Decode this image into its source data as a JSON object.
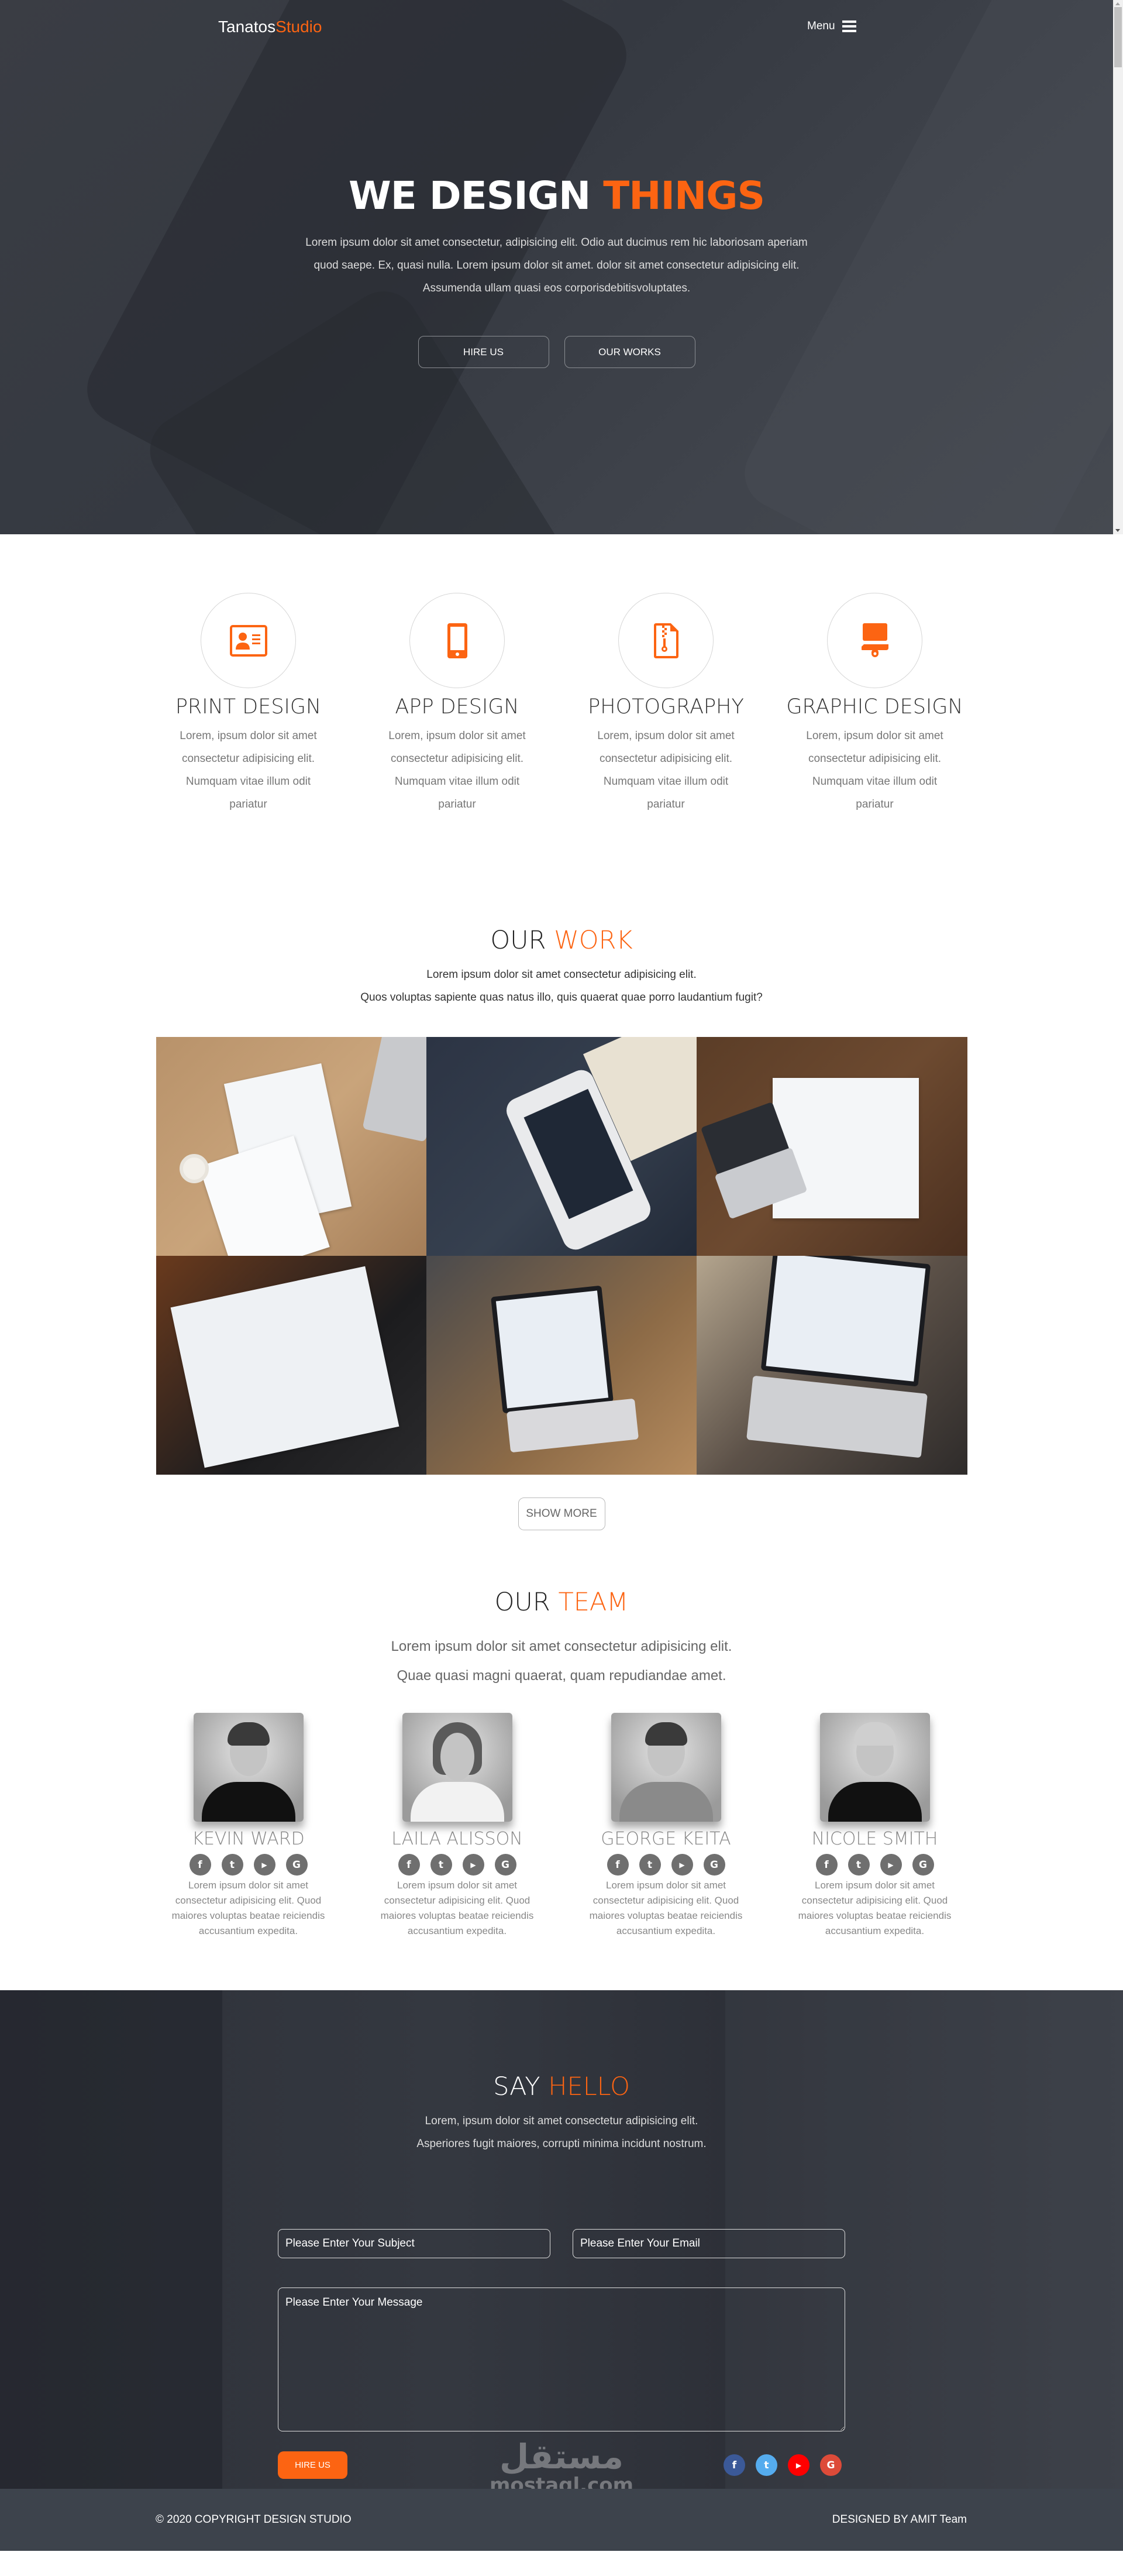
{
  "nav": {
    "logo_primary": "Tanatos",
    "logo_accent": "Studio",
    "menu_label": "Menu",
    "menu_icon": "hamburger-icon"
  },
  "hero": {
    "title_primary": "WE DESIGN",
    "title_accent": "THINGS",
    "text": "Lorem ipsum dolor sit amet consectetur, adipisicing elit. Odio aut ducimus rem hic laboriosam aperiam quod saepe. Ex, quasi nulla. Lorem ipsum dolor sit amet. dolor sit amet consectetur adipisicing elit. Assumenda ullam quasi eos corporisdebitisvoluptates.",
    "buttons": [
      {
        "label": "HIRE US"
      },
      {
        "label": "OUR WORKS"
      }
    ]
  },
  "services": [
    {
      "icon": "id-card-icon",
      "title": "PRINT DESIGN",
      "text": "Lorem, ipsum dolor sit amet consectetur adipisicing elit. Numquam vitae illum odit pariatur"
    },
    {
      "icon": "mobile-phone-icon",
      "title": "APP DESIGN",
      "text": "Lorem, ipsum dolor sit amet consectetur adipisicing elit. Numquam vitae illum odit pariatur"
    },
    {
      "icon": "file-zipper-icon",
      "title": "PHOTOGRAPHY",
      "text": "Lorem, ipsum dolor sit amet consectetur adipisicing elit. Numquam vitae illum odit pariatur"
    },
    {
      "icon": "paint-brush-icon",
      "title": "GRAPHIC DESIGN",
      "text": "Lorem, ipsum dolor sit amet consectetur adipisicing elit. Numquam vitae illum odit pariatur"
    }
  ],
  "work": {
    "title_primary": "OUR",
    "title_accent": "WORK",
    "line1": "Lorem ipsum dolor sit amet consectetur adipisicing elit.",
    "line2": "Quos voluptas sapiente quas natus illo, quis quaerat quae porro laudantium fugit?",
    "tiles": [
      {
        "name": "work-image-charts-documents"
      },
      {
        "name": "work-image-phone-earphones"
      },
      {
        "name": "work-image-planning-board"
      },
      {
        "name": "work-image-notebook-sketch"
      },
      {
        "name": "work-image-laptop-analytics"
      },
      {
        "name": "work-image-laptop-typing"
      }
    ],
    "show_more_label": "SHOW MORE"
  },
  "team": {
    "title_primary": "OUR",
    "title_accent": "TEAM",
    "line1": "Lorem ipsum dolor sit amet consectetur adipisicing elit.",
    "line2": "Quae quasi magni quaerat, quam repudiandae amet.",
    "members": [
      {
        "name": "KEVIN WARD",
        "text": "Lorem ipsum dolor sit amet consectetur adipisicing elit. Quod maiores voluptas beatae reiciendis accusantium expedita."
      },
      {
        "name": "LAILA ALISSON",
        "text": "Lorem ipsum dolor sit amet consectetur adipisicing elit. Quod maiores voluptas beatae reiciendis accusantium expedita."
      },
      {
        "name": "GEORGE KEITA",
        "text": "Lorem ipsum dolor sit amet consectetur adipisicing elit. Quod maiores voluptas beatae reiciendis accusantium expedita."
      },
      {
        "name": "NICOLE SMITH",
        "text": "Lorem ipsum dolor sit amet consectetur adipisicing elit. Quod maiores voluptas beatae reiciendis accusantium expedita."
      }
    ],
    "social_icons": [
      {
        "icon": "facebook-icon",
        "glyph": "f"
      },
      {
        "icon": "twitter-icon",
        "glyph": "t"
      },
      {
        "icon": "youtube-icon",
        "glyph": "▶"
      },
      {
        "icon": "google-icon",
        "glyph": "G"
      }
    ]
  },
  "contact": {
    "title_primary": "SAY",
    "title_accent": "HELLO",
    "line1": "Lorem, ipsum dolor sit amet consectetur adipisicing elit.",
    "line2": "Asperiores fugit maiores, corrupti minima incidunt nostrum.",
    "subject_placeholder": "Please Enter Your Subject",
    "email_placeholder": "Please Enter Your Email",
    "message_placeholder": "Please Enter Your Message",
    "submit_label": "HIRE US",
    "social_icons": [
      {
        "icon": "facebook-icon",
        "glyph": "f",
        "color": "#3b5998"
      },
      {
        "icon": "twitter-icon",
        "glyph": "t",
        "color": "#55acee"
      },
      {
        "icon": "youtube-icon",
        "glyph": "▶",
        "color": "#ff0000"
      },
      {
        "icon": "google-icon",
        "glyph": "G",
        "color": "#dd4b39"
      }
    ]
  },
  "watermark": {
    "arabic": "مستقل",
    "latin": "mostaql.com"
  },
  "footer": {
    "copyright": "© 2020 COPYRIGHT DESIGN STUDIO",
    "credit": "DESIGNED BY AMIT Team"
  },
  "colors": {
    "accent": "#fc6412",
    "hero_bg": "#3a3d44",
    "footer_bg": "#3d434c"
  }
}
